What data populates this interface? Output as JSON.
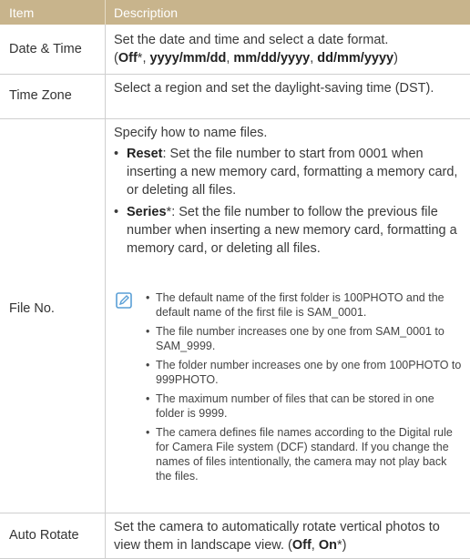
{
  "header": {
    "col_item": "Item",
    "col_desc": "Description"
  },
  "rows": {
    "date_time": {
      "item": "Date & Time",
      "line1": "Set the date and time and select a date format.",
      "formats": {
        "open": "(",
        "off": "Off",
        "star": "*",
        "sep1": ", ",
        "f1": "yyyy/mm/dd",
        "sep2": ", ",
        "f2": "mm/dd/yyyy",
        "sep3": ", ",
        "f3": "dd/mm/yyyy",
        "close": ")"
      }
    },
    "time_zone": {
      "item": "Time Zone",
      "desc": "Select a region and set the daylight-saving time (DST)."
    },
    "file_no": {
      "item": "File No.",
      "intro": "Specify how to name files.",
      "reset_label": "Reset",
      "reset_text": ": Set the file number to start from 0001 when inserting a new memory card, formatting a memory card, or deleting all files.",
      "series_label": "Series",
      "series_star": "*",
      "series_text": ": Set the file number to follow the previous file number when inserting a new memory card, formatting a memory card, or deleting all files.",
      "notes": [
        "The default name of the first folder is 100PHOTO and the default name of the first file is SAM_0001.",
        "The file number increases one by one from SAM_0001 to SAM_9999.",
        "The folder number increases one by one from 100PHOTO to 999PHOTO.",
        "The maximum number of files that can be stored in one folder is 9999.",
        "The camera defines file names according to the Digital rule for Camera File system (DCF) standard. If you change the names of files intentionally, the camera may not play back the files."
      ]
    },
    "auto_rotate": {
      "item": "Auto Rotate",
      "text": "Set the camera to automatically rotate vertical photos to view them in landscape view. (",
      "off": "Off",
      "sep": ", ",
      "on": "On",
      "star": "*",
      "close": ")"
    }
  },
  "colors": {
    "header_bg": "#c8b48c",
    "note_icon": "#5a9fd6",
    "grid": "#cfcfcf"
  },
  "icons": {
    "note": "pencil-note-icon",
    "bullet": "bullet-dot"
  }
}
